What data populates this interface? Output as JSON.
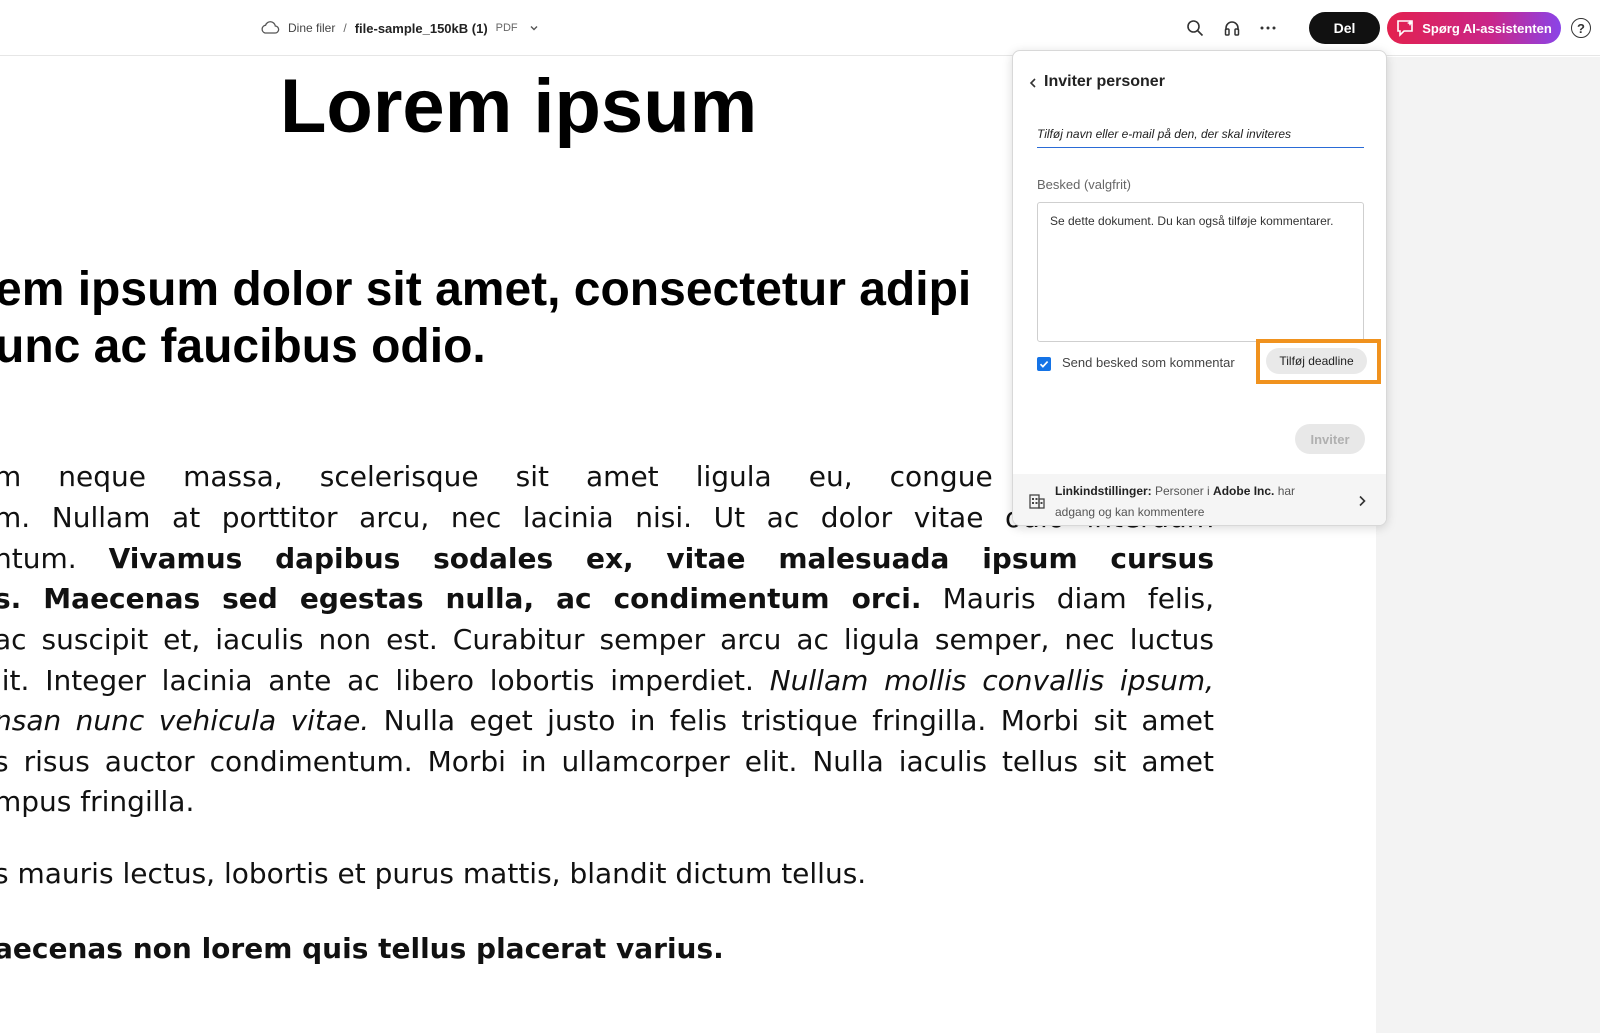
{
  "header": {
    "breadcrumb_root": "Dine filer",
    "breadcrumb_sep": "/",
    "file_name": "file-sample_150kB (1)",
    "file_type": "PDF",
    "share_label": "Del",
    "ai_label": "Spørg AI-assistenten",
    "help_label": "?"
  },
  "document": {
    "heading": "Lorem ipsum",
    "subheading_line1": "em ipsum dolor sit amet, consectetur adipi",
    "subheading_line2": "unc ac faucibus odio.",
    "para": {
      "l1": "m neque massa, scelerisque sit amet ligula eu, congue molestie m",
      "l2": "m. Nullam at porttitor arcu, nec lacinia nisi. Ut ac dolor vitae odio interdum",
      "l3_a": "ntum. ",
      "l3_b": "Vivamus dapibus sodales ex, vitae malesuada ipsum cursus",
      "l4_a": "s. Maecenas sed egestas nulla, ac condimentum orci.",
      "l4_b": " Mauris diam felis,",
      "l5": " ac suscipit et, iaculis non est. Curabitur semper arcu ac ligula semper, nec luctus",
      "l6_a": "lit. Integer lacinia ante ac libero lobortis imperdiet. ",
      "l6_b": "Nullam mollis convallis ipsum,",
      "l7_a": "nsan nunc vehicula vitae.",
      "l7_b": " Nulla eget justo in felis tristique fringilla. Morbi sit amet",
      "l8": "s risus auctor condimentum. Morbi in ullamcorper elit. Nulla iaculis tellus sit amet",
      "l9": "mpus fringilla."
    },
    "line_mauris": "s mauris lectus, lobortis et purus mattis, blandit dictum tellus.",
    "line_maecenas": "aecenas non lorem quis tellus placerat varius."
  },
  "share_panel": {
    "title": "Inviter personer",
    "invite_placeholder": "Tilføj navn eller e-mail på den, der skal inviteres",
    "message_label": "Besked (valgfrit)",
    "message_value": "Se dette dokument. Du kan også tilføje kommentarer.",
    "send_as_comment_label": "Send besked som kommentar",
    "send_as_comment_checked": true,
    "add_deadline_label": "Tilføj deadline",
    "invite_button": "Inviter",
    "link_settings_title": "Linkindstillinger:",
    "link_settings_text_a": " Personer i ",
    "link_settings_org": "Adobe Inc.",
    "link_settings_text_b": " har adgang og kan kommentere"
  },
  "colors": {
    "accent_blue": "#1473e6",
    "highlight_orange": "#f0921e",
    "ai_gradient_start": "#e3214e",
    "ai_gradient_end": "#8a44e8"
  },
  "icons": [
    "cloud-icon",
    "chevron-down-icon",
    "search-icon",
    "headphones-icon",
    "more-icon",
    "ai-chat-icon",
    "help-icon",
    "back-chevron-icon",
    "checkmark-icon",
    "building-icon",
    "chevron-right-icon"
  ]
}
